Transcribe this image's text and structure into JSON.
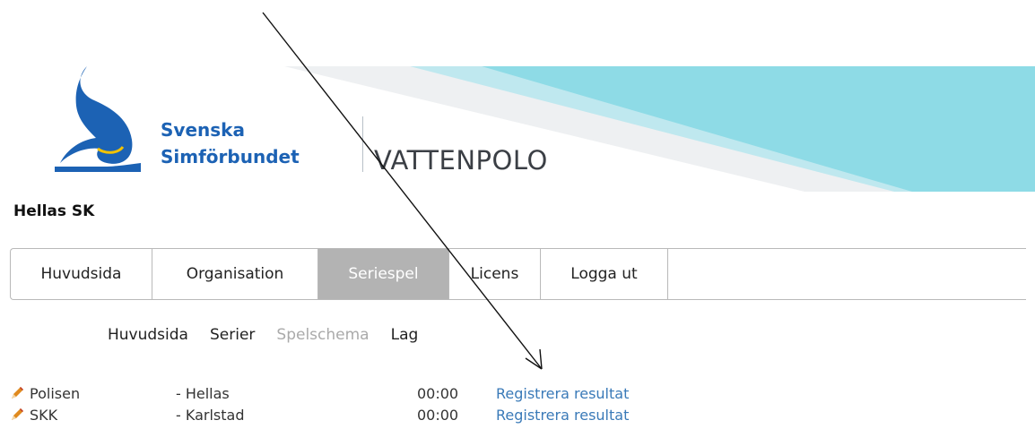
{
  "header": {
    "org_name_line1": "Svenska",
    "org_name_line2": "Simförbundet",
    "brand_title": "VATTENPOLO",
    "colors": {
      "brand_blue": "#1c62b4",
      "banner_cyan": "#8edbe6"
    }
  },
  "club": {
    "name": "Hellas SK"
  },
  "tabs": [
    {
      "label": "Huvudsida",
      "active": false
    },
    {
      "label": "Organisation",
      "active": false
    },
    {
      "label": "Seriespel",
      "active": true
    },
    {
      "label": "Licens",
      "active": false
    },
    {
      "label": "Logga ut",
      "active": false
    }
  ],
  "subnav": [
    {
      "label": "Huvudsida",
      "disabled": false
    },
    {
      "label": "Serier",
      "disabled": false
    },
    {
      "label": "Spelschema",
      "disabled": true
    },
    {
      "label": "Lag",
      "disabled": false
    }
  ],
  "matches": [
    {
      "icon": "pencil-icon",
      "home": "Polisen",
      "away": "- Hellas",
      "time": "00:00",
      "action": "Registrera resultat"
    },
    {
      "icon": "pencil-icon",
      "home": "SKK",
      "away": "- Karlstad",
      "time": "00:00",
      "action": "Registrera resultat"
    }
  ]
}
